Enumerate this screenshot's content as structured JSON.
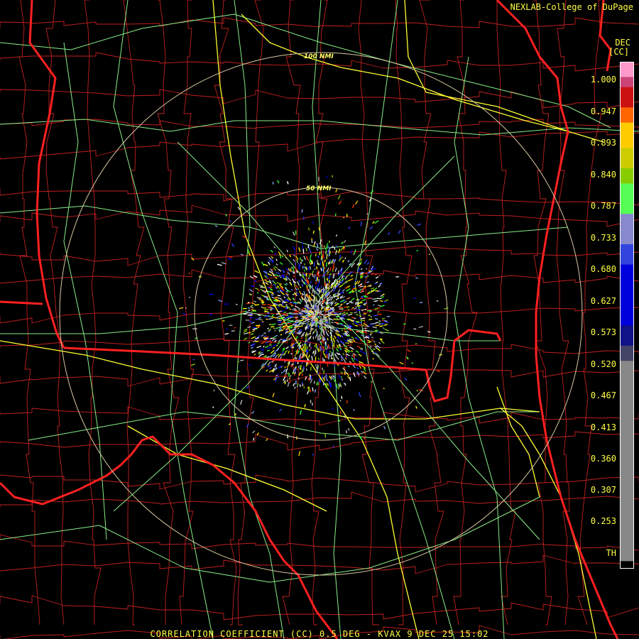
{
  "credit": "NEXLAB-College of DuPage",
  "unit": {
    "code": "DEC",
    "name": "[CC]"
  },
  "footer": "CORRELATION COEFFICIENT (CC) 0.5 DEG - KVAX 9 DEC 25 15:02",
  "range_rings": [
    {
      "label": "50 NMI"
    },
    {
      "label": "100 NMI"
    }
  ],
  "legend": {
    "ticks": [
      "1.000",
      "0.947",
      "0.893",
      "0.840",
      "0.787",
      "0.733",
      "0.680",
      "0.627",
      "0.573",
      "0.520",
      "0.467",
      "0.413",
      "0.360",
      "0.307",
      "0.253",
      "TH"
    ],
    "bands": [
      {
        "from": 0.0,
        "to": 0.03,
        "color": "#ff99cc"
      },
      {
        "from": 0.03,
        "to": 0.05,
        "color": "#cc4477"
      },
      {
        "from": 0.05,
        "to": 0.09,
        "color": "#cc1111"
      },
      {
        "from": 0.09,
        "to": 0.12,
        "color": "#ff6600"
      },
      {
        "from": 0.12,
        "to": 0.17,
        "color": "#ffcc00"
      },
      {
        "from": 0.17,
        "to": 0.21,
        "color": "#cccc00"
      },
      {
        "from": 0.21,
        "to": 0.24,
        "color": "#88cc00"
      },
      {
        "from": 0.24,
        "to": 0.3,
        "color": "#55ff55"
      },
      {
        "from": 0.3,
        "to": 0.36,
        "color": "#8888cc"
      },
      {
        "from": 0.36,
        "to": 0.4,
        "color": "#3344dd"
      },
      {
        "from": 0.4,
        "to": 0.52,
        "color": "#0000dd"
      },
      {
        "from": 0.52,
        "to": 0.56,
        "color": "#111188"
      },
      {
        "from": 0.56,
        "to": 0.59,
        "color": "#444466"
      },
      {
        "from": 0.59,
        "to": 0.985,
        "color": "#888888"
      },
      {
        "from": 0.985,
        "to": 1.0,
        "color": "#000000"
      }
    ]
  },
  "colors": {
    "state_lines": "#ff2020",
    "county_lines": "#c02020",
    "highways": "#ffff33",
    "roads": "#88ee88",
    "range_rings": "#d8c8a0",
    "text": "#ffff44"
  }
}
